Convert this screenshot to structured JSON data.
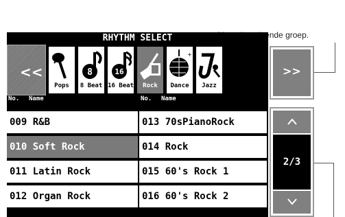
{
  "annotation": {
    "text": "Naar de volgende groep."
  },
  "screen": {
    "title": "RHYTHM SELECT",
    "prev_label": "<<",
    "next_label": ">>",
    "categories": [
      {
        "label": "Pops",
        "icon": "microphone-icon"
      },
      {
        "label": "8 Beat",
        "icon": "note-8-icon"
      },
      {
        "label": "16 Beat",
        "icon": "note-16-icon"
      },
      {
        "label": "Rock",
        "icon": "guitar-icon",
        "selected": true
      },
      {
        "label": "Dance",
        "icon": "disco-ball-icon"
      },
      {
        "label": "Jazz",
        "icon": "saxophone-icon"
      }
    ],
    "headers": {
      "no": "No.",
      "name": "Name"
    },
    "items": [
      {
        "text": "009 R&B"
      },
      {
        "text": "010 Soft Rock",
        "selected": true
      },
      {
        "text": "011 Latin Rock"
      },
      {
        "text": "012 Organ Rock"
      },
      {
        "text": "013 70sPianoRock"
      },
      {
        "text": "014 Rock"
      },
      {
        "text": "015 60's Rock 1"
      },
      {
        "text": "016 60's Rock 2"
      }
    ],
    "pager": {
      "up": "^",
      "page": "2/3",
      "down": "v"
    }
  },
  "colors": {
    "selected": "#7a7a7a",
    "button": "#808080",
    "background": "#000000"
  }
}
